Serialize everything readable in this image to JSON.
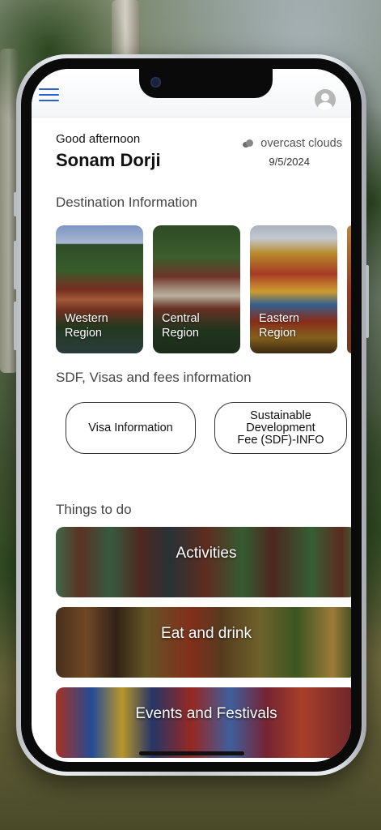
{
  "header": {
    "menu_icon": "hamburger-menu-icon",
    "avatar_icon": "user-avatar-icon",
    "accent_color": "#2b62c9"
  },
  "greeting": {
    "salutation": "Good afternoon",
    "name": "Sonam Dorji"
  },
  "weather": {
    "icon": "cloud-icon",
    "description": "overcast clouds",
    "date": "9/5/2024"
  },
  "destination": {
    "title": "Destination Information",
    "regions": [
      {
        "label": "Western\nRegion"
      },
      {
        "label": "Central\nRegion"
      },
      {
        "label": "Eastern\nRegion"
      }
    ]
  },
  "sdf": {
    "title": "SDF, Visas and fees information",
    "visa_button": "Visa Information",
    "sdf_button": "Sustainable\nDevelopment\nFee (SDF)-INFO"
  },
  "things_to_do": {
    "title": "Things to do",
    "items": [
      {
        "label": "Activities"
      },
      {
        "label": "Eat and drink"
      },
      {
        "label": "Events and Festivals"
      }
    ]
  }
}
